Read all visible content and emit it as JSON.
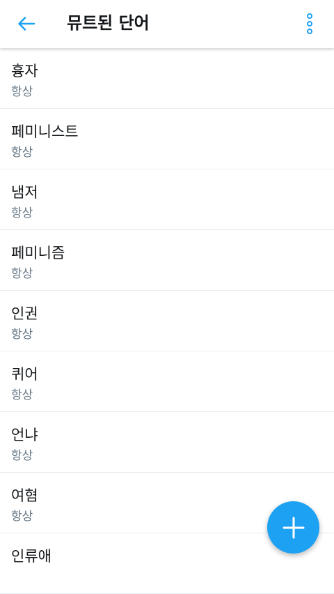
{
  "header": {
    "title": "뮤트된 단어",
    "back_icon": "arrow-left-icon",
    "more_icon": "vertical-dots-icon"
  },
  "muted_words": [
    {
      "word": "흉자",
      "duration": "항상"
    },
    {
      "word": "페미니스트",
      "duration": "항상"
    },
    {
      "word": "냄저",
      "duration": "항상"
    },
    {
      "word": "페미니즘",
      "duration": "항상"
    },
    {
      "word": "인권",
      "duration": "항상"
    },
    {
      "word": "퀴어",
      "duration": "항상"
    },
    {
      "word": "언냐",
      "duration": "항상"
    },
    {
      "word": "여혐",
      "duration": "항상"
    },
    {
      "word": "인류애",
      "duration": ""
    }
  ],
  "fab": {
    "icon": "plus-icon"
  },
  "colors": {
    "accent": "#1da1f2",
    "text_primary": "#14171a",
    "text_secondary": "#657786",
    "divider": "#e6ecf0"
  }
}
